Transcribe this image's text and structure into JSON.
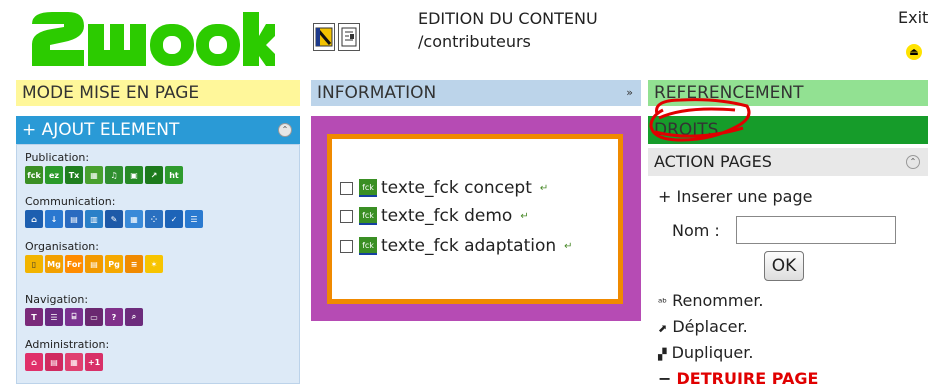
{
  "app": {
    "logo_text": "2WOOK",
    "colors": {
      "logo": "#2ccb00",
      "accent_blue": "#2a9ad6",
      "purple": "#b64bb4",
      "orange": "#f08a00",
      "green_dark": "#169c2a",
      "green_light": "#92e192",
      "yellow": "#fff79a",
      "info_blue": "#bcd4ea"
    }
  },
  "header": {
    "icons": [
      "save-page-icon",
      "page-layout-icon"
    ],
    "title": "EDITION DU CONTENU",
    "path": "/contributeurs",
    "exit_label": "Exit",
    "exit_icon": "eject-icon"
  },
  "bars": {
    "mode": "MODE MISE EN PAGE",
    "information": "INFORMATION",
    "referencement": "REFERENCEMENT",
    "droits": "DROITS"
  },
  "left": {
    "title": "+ AJOUT ELEMENT",
    "collapse_glyph": "⌃",
    "groups": [
      {
        "title": "Publication:",
        "icons": [
          "fck",
          "ez",
          "tx",
          "img",
          "mp",
          "gal",
          "link",
          "html"
        ]
      },
      {
        "title": "Communication:",
        "icons": [
          "bank",
          "down",
          "cal",
          "form",
          "pen",
          "grid",
          "dots",
          "poll",
          "chat"
        ]
      },
      {
        "title": "Organisation:",
        "icons": [
          "page",
          "mg",
          "for",
          "doc",
          "pg",
          "list",
          "star"
        ]
      },
      {
        "title": "Navigation:",
        "icons": [
          "nav1",
          "menu",
          "tree",
          "sitemap",
          "faq",
          "search"
        ]
      },
      {
        "title": "Administration:",
        "icons": [
          "adm1",
          "adm2",
          "adm3",
          "plus1"
        ]
      }
    ]
  },
  "center": {
    "items": [
      {
        "label": "texte_fck concept",
        "icon": "fck"
      },
      {
        "label": "texte_fck demo",
        "icon": "fck"
      },
      {
        "label": "texte_fck adaptation",
        "icon": "fck"
      }
    ]
  },
  "right": {
    "action_title": "ACTION PAGES",
    "insert_label": "+ Inserer une page",
    "nom_label": "Nom :",
    "nom_value": "",
    "ok_label": "OK",
    "rename_label": "Renommer.",
    "move_label": "Déplacer.",
    "duplicate_label": "Dupliquer.",
    "destroy_label": "DETRUIRE PAGE"
  }
}
